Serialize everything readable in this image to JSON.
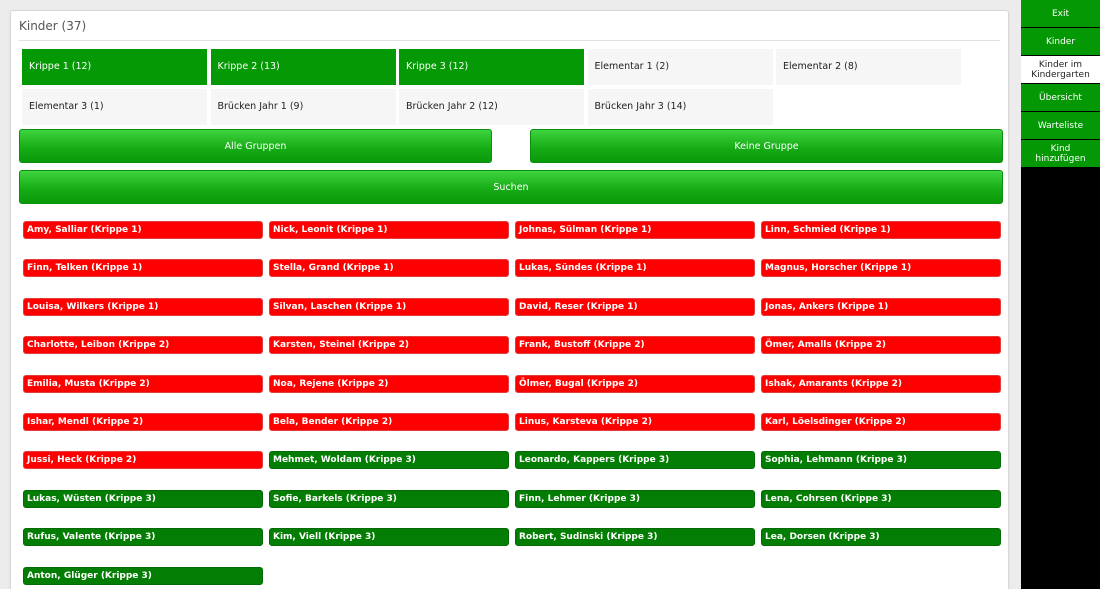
{
  "panel": {
    "title": "Kinder (37)"
  },
  "groups": [
    {
      "label": "Krippe 1 (12)",
      "active": true
    },
    {
      "label": "Krippe 2 (13)",
      "active": true
    },
    {
      "label": "Krippe 3 (12)",
      "active": true
    },
    {
      "label": "Elementar 1 (2)",
      "active": false
    },
    {
      "label": "Elementar 2 (8)",
      "active": false
    },
    {
      "label": "Elementar 3 (1)",
      "active": false
    },
    {
      "label": "Brücken Jahr 1 (9)",
      "active": false
    },
    {
      "label": "Brücken Jahr 2 (12)",
      "active": false
    },
    {
      "label": "Brücken Jahr 3 (14)",
      "active": false
    }
  ],
  "actions": {
    "all_groups": "Alle Gruppen",
    "no_group": "Keine Gruppe",
    "search": "Suchen"
  },
  "children": [
    {
      "label": "Amy, Salliar (Krippe 1)",
      "status": "red"
    },
    {
      "label": "Nick, Leonit (Krippe 1)",
      "status": "red"
    },
    {
      "label": "Johnas, Sülman (Krippe 1)",
      "status": "red"
    },
    {
      "label": "Linn, Schmied (Krippe 1)",
      "status": "red"
    },
    {
      "label": "Finn, Telken (Krippe 1)",
      "status": "red"
    },
    {
      "label": "Stella, Grand (Krippe 1)",
      "status": "red"
    },
    {
      "label": "Lukas, Sündes (Krippe 1)",
      "status": "red"
    },
    {
      "label": "Magnus, Horscher (Krippe 1)",
      "status": "red"
    },
    {
      "label": "Louisa, Wilkers (Krippe 1)",
      "status": "red"
    },
    {
      "label": "Silvan, Laschen (Krippe 1)",
      "status": "red"
    },
    {
      "label": "David, Reser (Krippe 1)",
      "status": "red"
    },
    {
      "label": "Jonas, Ankers (Krippe 1)",
      "status": "red"
    },
    {
      "label": "Charlotte, Leibon (Krippe 2)",
      "status": "red"
    },
    {
      "label": "Karsten, Steinel (Krippe 2)",
      "status": "red"
    },
    {
      "label": "Frank, Bustoff (Krippe 2)",
      "status": "red"
    },
    {
      "label": "Ömer, Amalls (Krippe 2)",
      "status": "red"
    },
    {
      "label": "Emilia, Musta (Krippe 2)",
      "status": "red"
    },
    {
      "label": "Noa, Rejene (Krippe 2)",
      "status": "red"
    },
    {
      "label": "Ölmer, Bugal (Krippe 2)",
      "status": "red"
    },
    {
      "label": "Ishak, Amarants (Krippe 2)",
      "status": "red"
    },
    {
      "label": "Ishar, Mendl (Krippe 2)",
      "status": "red"
    },
    {
      "label": "Bela, Bender (Krippe 2)",
      "status": "red"
    },
    {
      "label": "Linus, Karsteva (Krippe 2)",
      "status": "red"
    },
    {
      "label": "Karl, Löelsdinger (Krippe 2)",
      "status": "red"
    },
    {
      "label": "Jussi, Heck (Krippe 2)",
      "status": "red"
    },
    {
      "label": "Mehmet, Woldam (Krippe 3)",
      "status": "green"
    },
    {
      "label": "Leonardo, Kappers (Krippe 3)",
      "status": "green"
    },
    {
      "label": "Sophia, Lehmann (Krippe 3)",
      "status": "green"
    },
    {
      "label": "Lukas, Wüsten (Krippe 3)",
      "status": "green"
    },
    {
      "label": "Sofie, Barkels (Krippe 3)",
      "status": "green"
    },
    {
      "label": "Finn, Lehmer (Krippe 3)",
      "status": "green"
    },
    {
      "label": "Lena, Cohrsen (Krippe 3)",
      "status": "green"
    },
    {
      "label": "Rufus, Valente (Krippe 3)",
      "status": "green"
    },
    {
      "label": "Kim, Viell (Krippe 3)",
      "status": "green"
    },
    {
      "label": "Robert, Sudinski (Krippe 3)",
      "status": "green"
    },
    {
      "label": "Lea, Dorsen (Krippe 3)",
      "status": "green"
    },
    {
      "label": "Anton, Glüger (Krippe 3)",
      "status": "green"
    }
  ],
  "sidebar": {
    "exit": "Exit",
    "children": "Kinder",
    "in_kindergarten_1": "Kinder im",
    "in_kindergarten_2": "Kindergarten",
    "overview": "Übersicht",
    "waitlist": "Warteliste",
    "add_child_1": "Kind",
    "add_child_2": "hinzufügen"
  },
  "colors": {
    "active_green": "#059905",
    "present_green": "#047d04",
    "absent_red": "#ff0000"
  }
}
